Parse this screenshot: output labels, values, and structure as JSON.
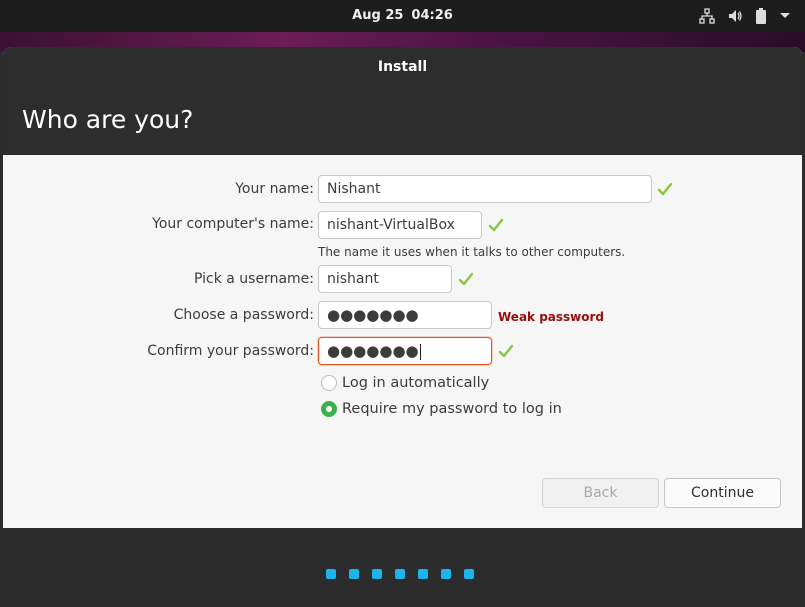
{
  "topbar": {
    "date": "Aug 25",
    "time": "04:26",
    "icons": [
      "network-wired-icon",
      "volume-icon",
      "battery-icon",
      "chevron-down-icon"
    ]
  },
  "window": {
    "title": "Install",
    "heading": "Who are you?"
  },
  "form": {
    "name_label": "Your name:",
    "name_value": "Nishant",
    "computer_label": "Your computer's name:",
    "computer_value": "nishant-VirtualBox",
    "computer_hint": "The name it uses when it talks to other computers.",
    "username_label": "Pick a username:",
    "username_value": "nishant",
    "password_label": "Choose a password:",
    "password_value": "●●●●●●●",
    "password_strength": "Weak password",
    "confirm_label": "Confirm your password:",
    "confirm_value": "●●●●●●●",
    "login_auto_label": "Log in automatically",
    "login_require_label": "Require my password to log in",
    "selected_login_option": "Require my password to log in"
  },
  "buttons": {
    "back": "Back",
    "continue": "Continue"
  },
  "colors": {
    "check_green": "#8cc63f",
    "radio_green": "#3bb04a",
    "weak_red": "#9b0c0c",
    "focus_orange": "#e95420",
    "progress_blue": "#19b6ee"
  },
  "progress": {
    "steps": 7
  }
}
